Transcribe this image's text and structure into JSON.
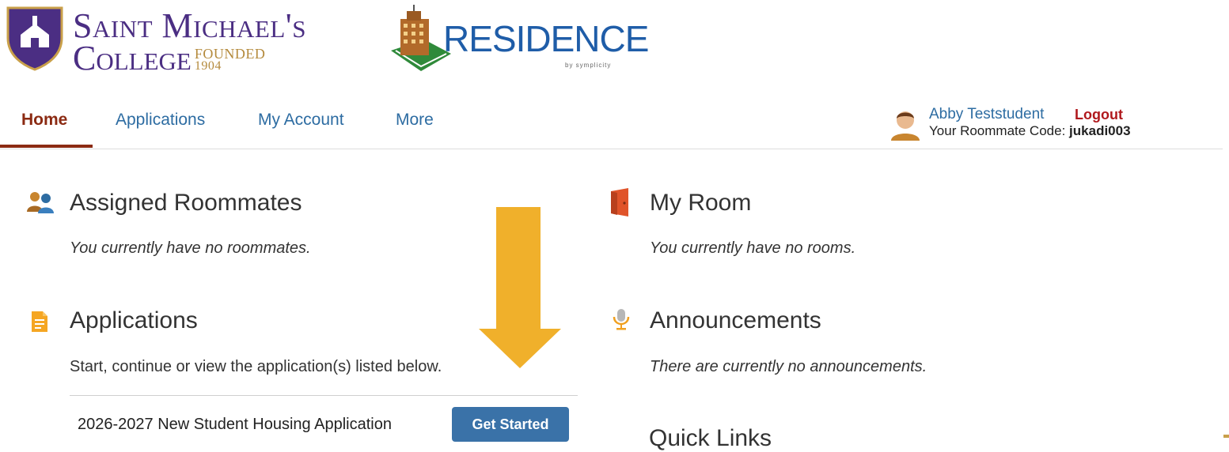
{
  "header": {
    "college": {
      "line1": "Saint Michael's",
      "line2": "College",
      "founded": "FOUNDED",
      "year": "1904"
    },
    "residence": {
      "title": "RESIDENCE",
      "sub": "by symplicity"
    }
  },
  "nav": {
    "items": [
      {
        "label": "Home",
        "active": true
      },
      {
        "label": "Applications",
        "active": false
      },
      {
        "label": "My Account",
        "active": false
      },
      {
        "label": "More",
        "active": false
      }
    ],
    "accent": "#8b2a12",
    "link_color": "#2d6ca2"
  },
  "user": {
    "name": "Abby Teststudent",
    "logout": "Logout",
    "roommate_code_label": "Your Roommate Code:",
    "roommate_code": "jukadi003"
  },
  "sections": {
    "roommates": {
      "title": "Assigned Roommates",
      "text": "You currently have no roommates.",
      "icon": "roommates-icon"
    },
    "applications": {
      "title": "Applications",
      "text": "Start, continue or view the application(s) listed below.",
      "icon": "document-icon",
      "items": [
        {
          "name": "2026-2027 New Student Housing Application",
          "button": "Get Started"
        }
      ]
    },
    "room": {
      "title": "My Room",
      "text": "You currently have no rooms.",
      "icon": "door-icon"
    },
    "announcements": {
      "title": "Announcements",
      "text": "There are currently no announcements.",
      "icon": "microphone-icon"
    },
    "quick_links": {
      "title": "Quick Links"
    }
  },
  "colors": {
    "button": "#3a72a8",
    "arrow": "#f0b02b",
    "brand_purple": "#4b2e83"
  }
}
